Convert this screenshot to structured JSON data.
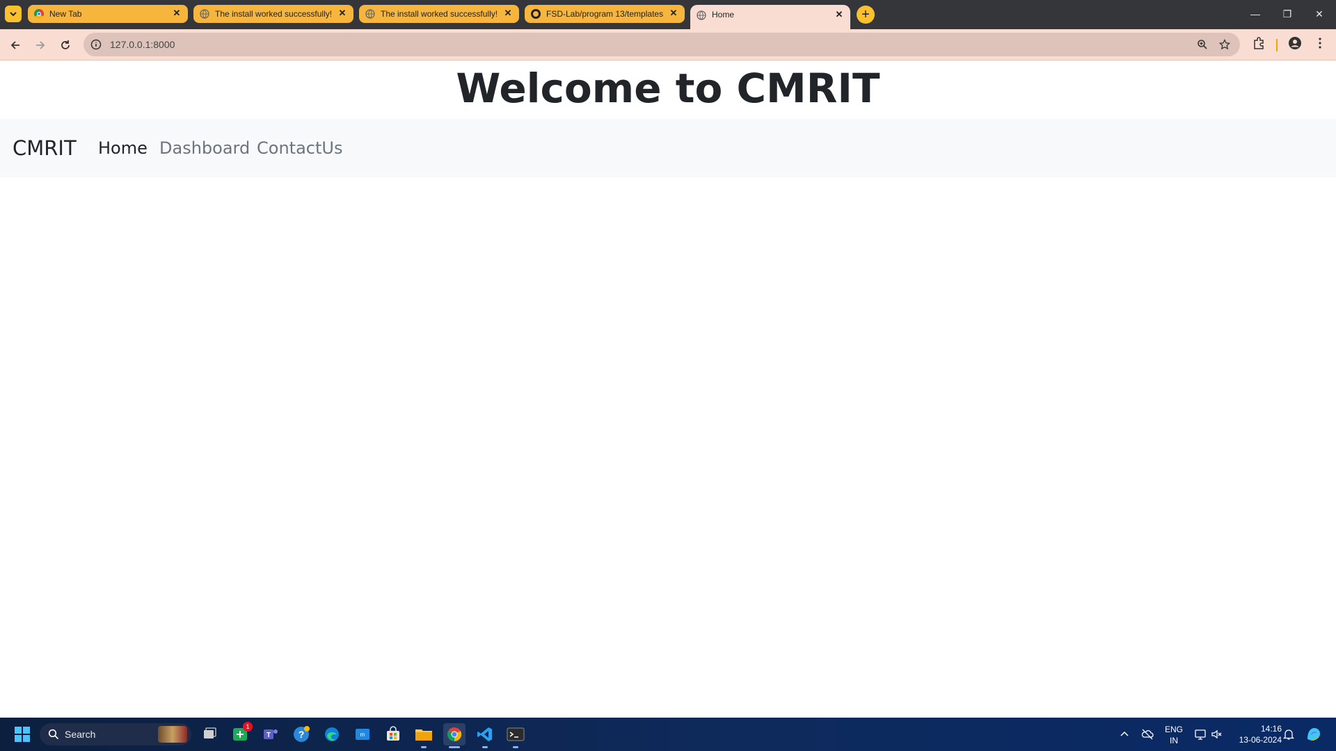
{
  "browser": {
    "tabs": [
      {
        "title": "New Tab",
        "icon": "chrome-icon",
        "active": false
      },
      {
        "title": "The install worked successfully!",
        "icon": "globe-icon",
        "active": false
      },
      {
        "title": "The install worked successfully!",
        "icon": "globe-icon",
        "active": false
      },
      {
        "title": "FSD-Lab/program 13/templates",
        "icon": "github-icon",
        "active": false
      },
      {
        "title": "Home",
        "icon": "globe-icon",
        "active": true
      }
    ],
    "new_tab_label": "+",
    "address": "127.0.0.1:8000",
    "colors": {
      "tab_inactive": "#f6b53d",
      "tab_active": "#f9ddd2",
      "frame": "#35363a"
    }
  },
  "page": {
    "heading": "Welcome to CMRIT",
    "navbar": {
      "brand": "CMRIT",
      "links": [
        {
          "label": "Home",
          "active": true
        },
        {
          "label": "Dashboard",
          "active": false
        },
        {
          "label": "ContactUs",
          "active": false
        }
      ]
    }
  },
  "taskbar": {
    "search_label": "Search",
    "teams_badge": "1",
    "language": "ENG",
    "region": "IN",
    "time": "14:16",
    "date": "13-06-2024",
    "apps": [
      "windows-start-icon",
      "search-icon",
      "task-view-icon",
      "whatsapp-icon",
      "teams-icon",
      "help-icon",
      "edge-icon",
      "mobile-app-icon",
      "store-icon",
      "file-explorer-icon",
      "chrome-icon",
      "vscode-icon",
      "terminal-icon"
    ]
  }
}
